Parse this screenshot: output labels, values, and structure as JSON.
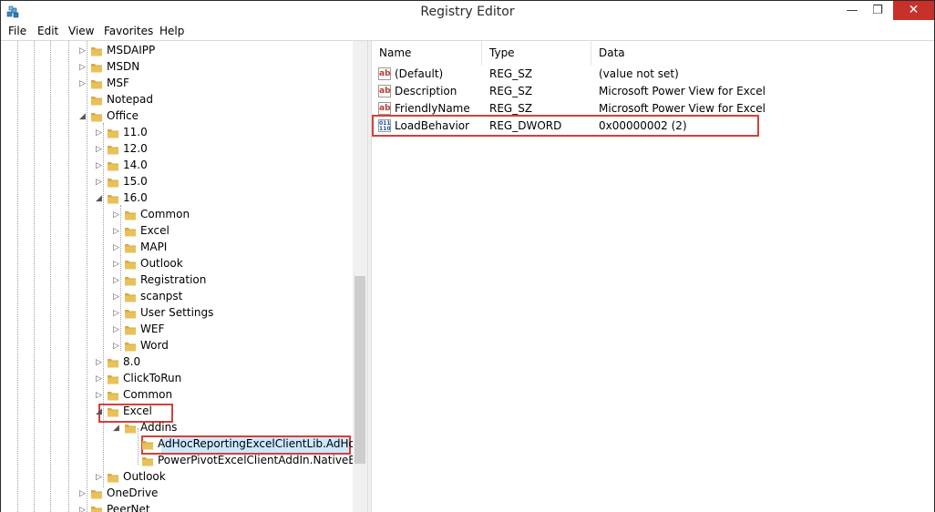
{
  "window": {
    "title": "Registry Editor"
  },
  "menu": [
    "File",
    "Edit",
    "View",
    "Favorites",
    "Help"
  ],
  "tree": [
    {
      "label": "MSDAIPP",
      "expander": "▷"
    },
    {
      "label": "MSDN",
      "expander": "▷"
    },
    {
      "label": "MSF",
      "expander": "▷"
    },
    {
      "label": "Notepad",
      "expander": ""
    },
    {
      "label": "Office",
      "expander": "◢"
    },
    {
      "label": "11.0",
      "expander": "▷"
    },
    {
      "label": "12.0",
      "expander": "▷"
    },
    {
      "label": "14.0",
      "expander": "▷"
    },
    {
      "label": "15.0",
      "expander": "▷"
    },
    {
      "label": "16.0",
      "expander": "◢"
    },
    {
      "label": "Common",
      "expander": "▷"
    },
    {
      "label": "Excel",
      "expander": "▷"
    },
    {
      "label": "MAPI",
      "expander": "▷"
    },
    {
      "label": "Outlook",
      "expander": "▷"
    },
    {
      "label": "Registration",
      "expander": "▷"
    },
    {
      "label": "scanpst",
      "expander": "▷"
    },
    {
      "label": "User Settings",
      "expander": "▷"
    },
    {
      "label": "WEF",
      "expander": "▷"
    },
    {
      "label": "Word",
      "expander": "▷"
    },
    {
      "label": "8.0",
      "expander": "▷"
    },
    {
      "label": "ClickToRun",
      "expander": "▷"
    },
    {
      "label": "Common",
      "expander": "▷"
    },
    {
      "label": "Excel",
      "expander": "◢"
    },
    {
      "label": "Addins",
      "expander": "◢"
    },
    {
      "label": "AdHocReportingExcelClientLib.AdHoc",
      "expander": ""
    },
    {
      "label": "PowerPivotExcelClientAddIn.NativeEntr",
      "expander": ""
    },
    {
      "label": "Outlook",
      "expander": "▷"
    },
    {
      "label": "OneDrive",
      "expander": "▷"
    },
    {
      "label": "PeerNet",
      "expander": "▷"
    }
  ],
  "list": {
    "columns": [
      "Name",
      "Type",
      "Data"
    ],
    "rows": [
      {
        "icon": "string-value-icon",
        "name": "(Default)",
        "type": "REG_SZ",
        "data": "(value not set)"
      },
      {
        "icon": "string-value-icon",
        "name": "Description",
        "type": "REG_SZ",
        "data": "Microsoft Power View for Excel"
      },
      {
        "icon": "string-value-icon",
        "name": "FriendlyName",
        "type": "REG_SZ",
        "data": "Microsoft Power View for Excel"
      },
      {
        "icon": "binary-value-icon",
        "name": "LoadBehavior",
        "type": "REG_DWORD",
        "data": "0x00000002 (2)"
      }
    ]
  },
  "colors": {
    "highlight": "#d4403a",
    "close_button": "#c7312a",
    "folder": "#e8c15a",
    "selection": "#cce8ff"
  }
}
